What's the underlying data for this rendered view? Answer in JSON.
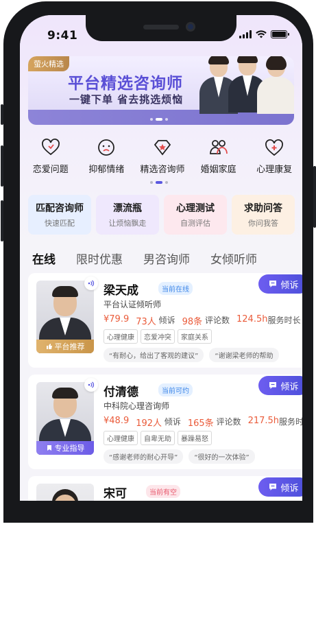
{
  "status_bar": {
    "time": "9:41",
    "icons": [
      "signal-icon",
      "wifi-icon",
      "battery-icon"
    ]
  },
  "banner": {
    "tag": "萤火精选",
    "title": "平台精选咨询师",
    "subtitle": "一键下单 省去挑选烦恼",
    "page_count": 3,
    "active_page": 2
  },
  "categories": [
    {
      "label": "恋爱问题",
      "icon": "heart-icon"
    },
    {
      "label": "抑郁情绪",
      "icon": "sad-face-icon"
    },
    {
      "label": "精选咨询师",
      "icon": "diamond-icon"
    },
    {
      "label": "婚姻家庭",
      "icon": "couple-icon"
    },
    {
      "label": "心理康复",
      "icon": "heart-plus-icon"
    }
  ],
  "features": [
    {
      "title": "匹配咨询师",
      "subtitle": "快速匹配",
      "color": "#e7efff"
    },
    {
      "title": "漂流瓶",
      "subtitle": "让烦恼飘走",
      "color": "#efe8fd"
    },
    {
      "title": "心理测试",
      "subtitle": "自测评估",
      "color": "#fde8ee"
    },
    {
      "title": "求助问答",
      "subtitle": "你问我答",
      "color": "#fdf0e3"
    }
  ],
  "tabs": [
    {
      "label": "在线",
      "active": true
    },
    {
      "label": "限时优惠",
      "active": false
    },
    {
      "label": "男咨询师",
      "active": false
    },
    {
      "label": "女倾听师",
      "active": false
    }
  ],
  "counselors": [
    {
      "name": "梁天成",
      "status": "当前在线",
      "title": "平台认证倾听师",
      "price": "¥79.9",
      "listeners": "73人",
      "listeners_label": "倾诉",
      "comments": "98条",
      "comments_label": "评论数",
      "hours": "124.5h",
      "hours_label": "服务时长",
      "tags": [
        "心理健康",
        "恋爱冲突",
        "家庭关系"
      ],
      "reviews": [
        "“有耐心，给出了客观的建议”",
        "“谢谢梁老师的帮助"
      ],
      "badge": "平台推荐",
      "complain_label": "倾诉"
    },
    {
      "name": "付清德",
      "status": "当前可约",
      "title": "中科院心理咨询师",
      "price": "¥48.9",
      "listeners": "192人",
      "listeners_label": "倾诉",
      "comments": "165条",
      "comments_label": "评论数",
      "hours": "217.5h",
      "hours_label": "服务时长",
      "tags": [
        "心理健康",
        "自卑无助",
        "暴躁易怒"
      ],
      "reviews": [
        "“感谢老师的耐心开导”",
        "“很好的一次体验”"
      ],
      "badge": "专业指导",
      "complain_label": "倾诉"
    },
    {
      "name": "宋可",
      "status": "当前有空",
      "complain_label": "倾诉"
    }
  ]
}
